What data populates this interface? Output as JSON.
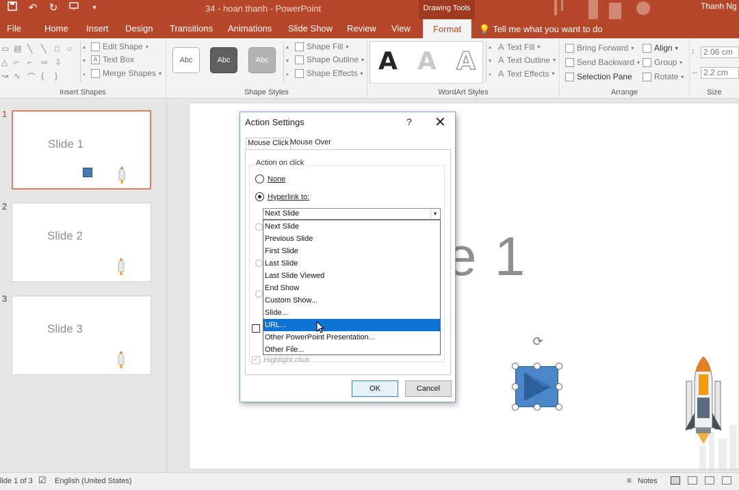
{
  "window": {
    "doc_title": "34 - hoan thanh  -  PowerPoint",
    "context_label": "Drawing Tools",
    "user_name": "Thanh Ng"
  },
  "qat": {
    "save_icon": "save-icon",
    "undo_icon": "undo-icon",
    "redo_icon": "redo-icon",
    "present_icon": "present-icon"
  },
  "tabs": [
    {
      "label": "File"
    },
    {
      "label": "Home"
    },
    {
      "label": "Insert"
    },
    {
      "label": "Design"
    },
    {
      "label": "Transitions"
    },
    {
      "label": "Animations"
    },
    {
      "label": "Slide Show"
    },
    {
      "label": "Review"
    },
    {
      "label": "View"
    },
    {
      "label": "Format",
      "active": true
    }
  ],
  "tell_me": "Tell me what you want to do",
  "ribbon": {
    "insert_shapes": {
      "label": "Insert Shapes",
      "edit_shape": "Edit Shape",
      "text_box": "Text Box",
      "merge_shapes": "Merge Shapes"
    },
    "shape_styles": {
      "label": "Shape Styles",
      "swatch_text": "Abc",
      "shape_fill": "Shape Fill",
      "shape_outline": "Shape Outline",
      "shape_effects": "Shape Effects"
    },
    "wordart": {
      "label": "WordArt Styles",
      "letter": "A",
      "text_fill": "Text Fill",
      "text_outline": "Text Outline",
      "text_effects": "Text Effects"
    },
    "arrange": {
      "label": "Arrange",
      "bring_forward": "Bring Forward",
      "send_backward": "Send Backward",
      "selection_pane": "Selection Pane",
      "align": "Align",
      "group": "Group",
      "rotate": "Rotate"
    },
    "size": {
      "label": "Size",
      "height": "2.06 cm",
      "width": "2.2 cm"
    }
  },
  "slides": [
    {
      "num": "1",
      "title": "Slide 1",
      "selected": true
    },
    {
      "num": "2",
      "title": "Slide 2"
    },
    {
      "num": "3",
      "title": "Slide 3"
    }
  ],
  "canvas": {
    "title_fragment": "e 1"
  },
  "dialog": {
    "title": "Action Settings",
    "help": "?",
    "close": "✕",
    "tabs": [
      "Mouse Click",
      "Mouse Over"
    ],
    "group_caption": "Action on click",
    "none_label": "None",
    "hyperlink_label": "Hyperlink to:",
    "combo_value": "Next Slide",
    "options": [
      "Next Slide",
      "Previous Slide",
      "First Slide",
      "Last Slide",
      "Last Slide Viewed",
      "End Show",
      "Custom Show...",
      "Slide...",
      "URL...",
      "Other PowerPoint Presentation...",
      "Other File..."
    ],
    "selected_option": "URL...",
    "highlight_click": "Highlight click",
    "ok": "OK",
    "cancel": "Cancel"
  },
  "status": {
    "slide_info": "lide 1 of 3",
    "language": "English (United States)",
    "notes": "Notes"
  },
  "colors": {
    "accent": "#b7472a",
    "selection": "#0f73d6",
    "shape_fill": "#4a86c8"
  }
}
